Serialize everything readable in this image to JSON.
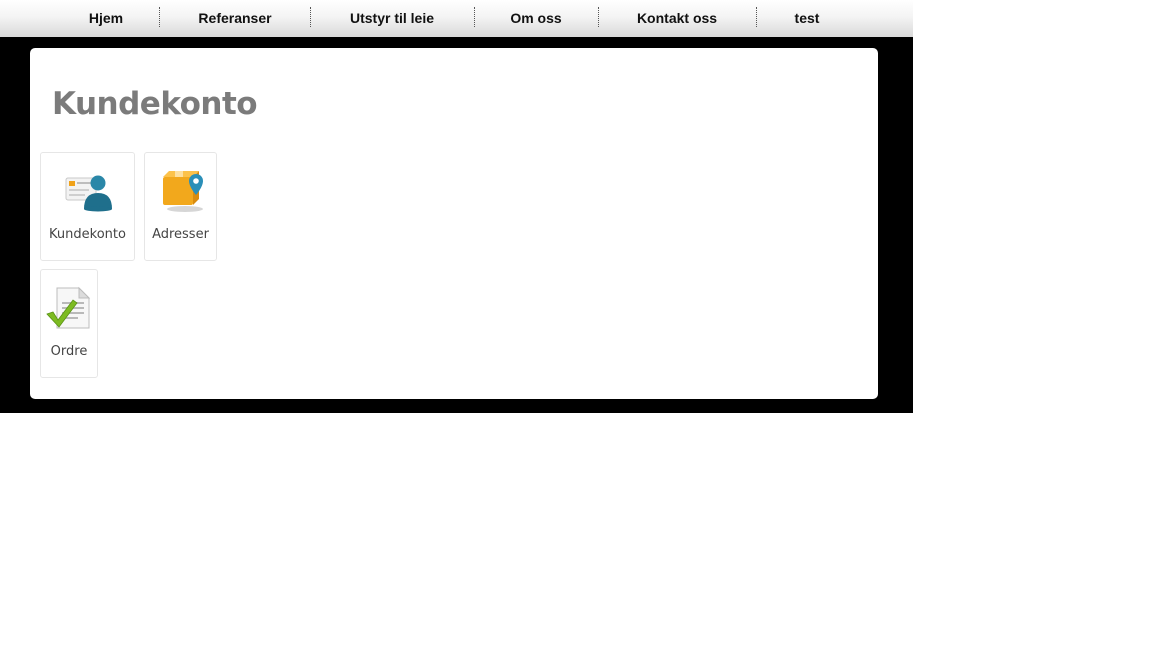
{
  "nav": {
    "items": [
      {
        "label": "Hjem"
      },
      {
        "label": "Referanser"
      },
      {
        "label": "Utstyr til leie"
      },
      {
        "label": "Om oss"
      },
      {
        "label": "Kontakt oss"
      },
      {
        "label": "test"
      }
    ]
  },
  "main": {
    "title": "Kundekonto",
    "tiles": [
      {
        "label": "Kundekonto",
        "icon": "user-card-icon"
      },
      {
        "label": "Adresser",
        "icon": "address-box-pin-icon"
      },
      {
        "label": "Ordre",
        "icon": "order-document-check-icon"
      }
    ]
  },
  "colors": {
    "page_background": "#000000",
    "panel_background": "#ffffff",
    "title_text": "#7b7b7b",
    "user_icon": "#2a87a8",
    "box_icon": "#f0a21a",
    "check_icon": "#7dbb22"
  }
}
